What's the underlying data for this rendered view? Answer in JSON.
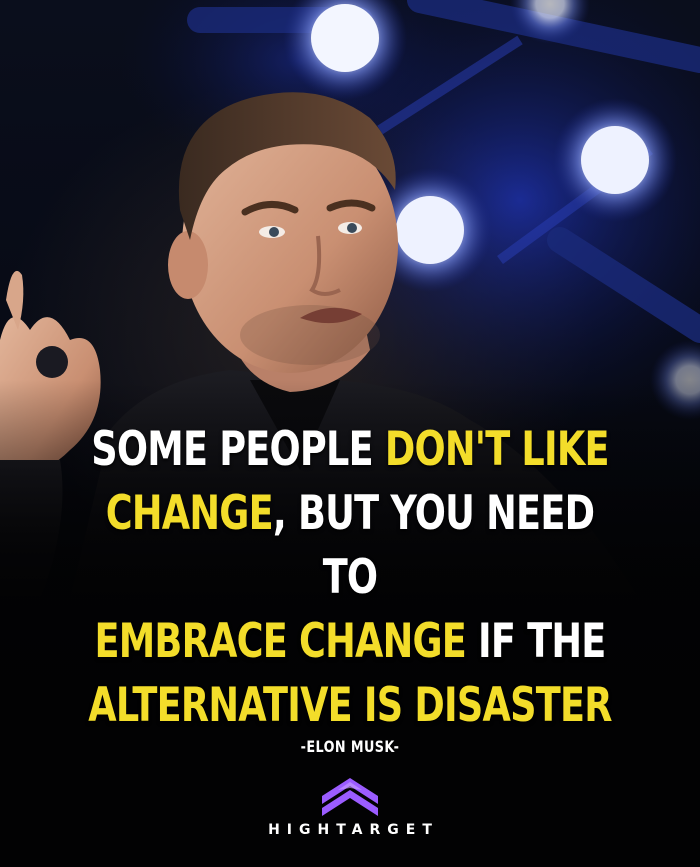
{
  "quote": {
    "line1": [
      {
        "text": "SOME PEOPLE ",
        "color": "white"
      },
      {
        "text": "DON'T LIKE",
        "color": "yellow"
      }
    ],
    "line2": [
      {
        "text": "CHANGE",
        "color": "yellow"
      },
      {
        "text": ", BUT YOU NEED TO",
        "color": "white"
      }
    ],
    "line3": [
      {
        "text": "EMBRACE CHANGE",
        "color": "yellow"
      },
      {
        "text": " IF THE",
        "color": "white"
      }
    ],
    "line4": [
      {
        "text": "ALTERNATIVE IS DISASTER",
        "color": "yellow"
      }
    ]
  },
  "author": "-ELON MUSK-",
  "brand": {
    "name": "HIGHTARGET",
    "logo_icon": "chevron-stack-logo-icon",
    "logo_color": "#9b5cff"
  },
  "colors": {
    "accent_yellow": "#f3dd2a",
    "text_white": "#ffffff",
    "background": "#05070c"
  },
  "photo": {
    "subject": "man-speaking-on-stage-photo"
  }
}
